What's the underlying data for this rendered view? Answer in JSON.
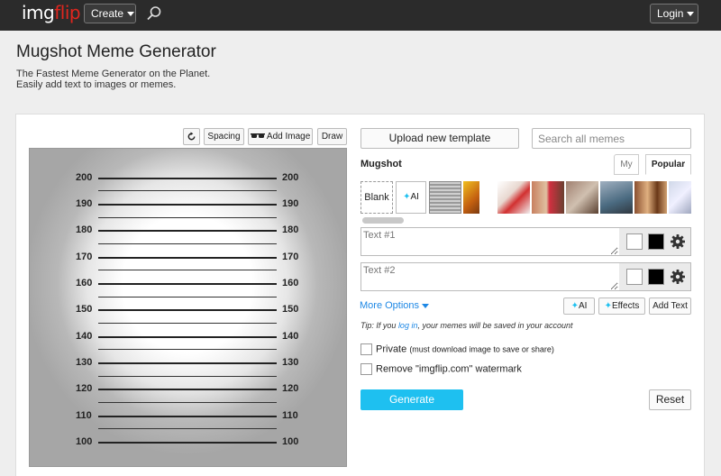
{
  "nav": {
    "logo_part1": "img",
    "logo_part2": "flip",
    "create_label": "Create",
    "login_label": "Login"
  },
  "header": {
    "title": "Mugshot Meme Generator",
    "subtitle": "The Fastest Meme Generator on the Planet. Easily add text to images or memes."
  },
  "toolbar": {
    "spacing": "Spacing",
    "add_image": "Add Image",
    "draw": "Draw"
  },
  "meme": {
    "height_marks": [
      "200",
      "190",
      "180",
      "170",
      "160",
      "150",
      "140",
      "130",
      "120",
      "110",
      "100"
    ]
  },
  "upload_label": "Upload new template",
  "search": {
    "placeholder": "Search all memes"
  },
  "template_section": {
    "label": "Mugshot",
    "tabs": {
      "my": "My",
      "popular": "Popular"
    },
    "blank_label": "Blank",
    "ai_label": "AI"
  },
  "text_boxes": [
    {
      "placeholder": "Text #1",
      "color1": "#ffffff",
      "color2": "#000000"
    },
    {
      "placeholder": "Text #2",
      "color1": "#ffffff",
      "color2": "#000000"
    }
  ],
  "more_options": "More Options",
  "tools": {
    "ai": "AI",
    "effects": "Effects",
    "add_text": "Add Text"
  },
  "tip": {
    "prefix": "Tip: If you ",
    "link": "log in",
    "suffix": ", your memes will be saved in your account"
  },
  "options": {
    "private_label": "Private",
    "private_note": "(must download image to save or share)",
    "watermark_label": "Remove \"imgflip.com\" watermark"
  },
  "actions": {
    "generate": "Generate",
    "reset": "Reset"
  },
  "colors": {
    "accent": "#1ec0f0",
    "link": "#1e88e5",
    "brand_red": "#e0261e",
    "topbar": "#2b2b2b"
  }
}
